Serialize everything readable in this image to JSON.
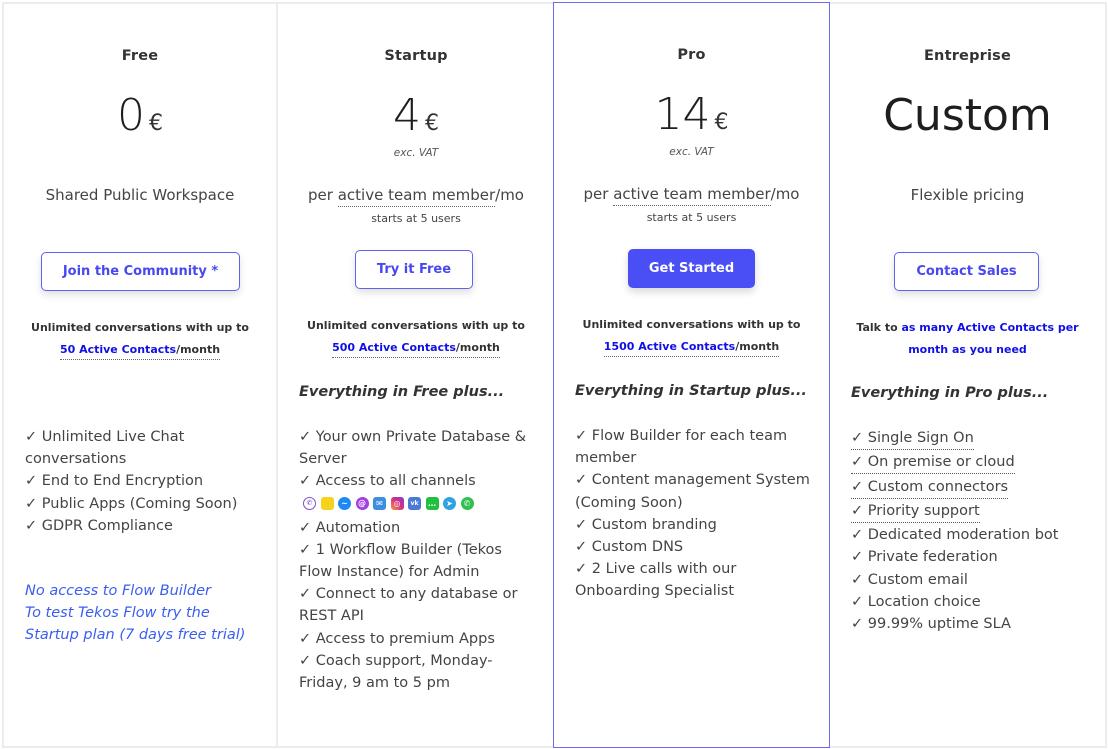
{
  "plans": [
    {
      "name": "Free",
      "price": "0",
      "currency": "€",
      "subtitle": "Shared Public Workspace",
      "button": "Join the Community *",
      "contacts_prefix": "Unlimited conversations with up to",
      "contacts_link": "50 Active Contacts",
      "contacts_suffix": "/month",
      "features": [
        "✓ Unlimited Live Chat conversations",
        "✓ End to End Encryption",
        "✓ Public Apps (Coming Soon)",
        "✓ GDPR Compliance"
      ],
      "note": [
        "No access to Flow Builder",
        "To test Tekos Flow try the",
        "Startup plan (7 days free trial)"
      ]
    },
    {
      "name": "Startup",
      "price": "4",
      "currency": "€",
      "vat": "exc. VAT",
      "per": "per",
      "per_dotted": "active team member",
      "per_suffix": "/mo",
      "starts": "starts at 5 users",
      "button": "Try it Free",
      "contacts_prefix": "Unlimited conversations with up to",
      "contacts_link": "500 Active Contacts",
      "contacts_suffix": "/month",
      "everything": "Everything in Free plus...",
      "features_a": [
        "✓ Your own Private Database & Server",
        "✓ Access to all channels"
      ],
      "channels": [
        "viber-icon",
        "snapchat-icon",
        "messenger-icon",
        "email-at-icon",
        "mail-icon",
        "instagram-icon",
        "vk-icon",
        "line-icon",
        "telegram-icon",
        "whatsapp-icon"
      ],
      "features_b": [
        "✓ Automation",
        "✓ 1 Workflow Builder (Tekos Flow Instance) for Admin",
        "✓ Connect to any database or REST API",
        "✓ Access to premium Apps",
        "✓ Coach support, Monday-Friday, 9 am to 5 pm"
      ]
    },
    {
      "name": "Pro",
      "price": "14",
      "currency": "€",
      "vat": "exc. VAT",
      "per": "per",
      "per_dotted": "active team member",
      "per_suffix": "/mo",
      "starts": "starts at 5 users",
      "button": "Get Started",
      "contacts_prefix": "Unlimited conversations with up to",
      "contacts_link": "1500 Active Contacts",
      "contacts_suffix": "/month",
      "everything": "Everything in Startup plus...",
      "features": [
        "✓ Flow Builder for each team member",
        "✓ Content management System (Coming Soon)",
        "✓ Custom branding",
        "✓ Custom DNS",
        "✓ 2 Live calls with our Onboarding Specialist"
      ]
    },
    {
      "name": "Entreprise",
      "price": "Custom",
      "subtitle": "Flexible pricing",
      "button": "Contact Sales",
      "contacts_prefix": "Talk to",
      "contacts_link_1": "as many Active Contacts per",
      "contacts_link_2": "month as you need",
      "everything": "Everything in Pro plus...",
      "features_dotted": [
        "✓ Single Sign On",
        "✓ On premise or cloud",
        "✓ Custom connectors",
        "✓ Priority support"
      ],
      "features": [
        "✓ Dedicated moderation bot",
        "✓ Private federation",
        "✓ Custom email",
        "✓ Location choice",
        "✓ 99.99% uptime SLA"
      ]
    }
  ],
  "colors": {
    "accent": "#4a4ef5",
    "link": "#1010e6",
    "note": "#3b5ef0",
    "highlight_border": "#6b6bf0"
  }
}
